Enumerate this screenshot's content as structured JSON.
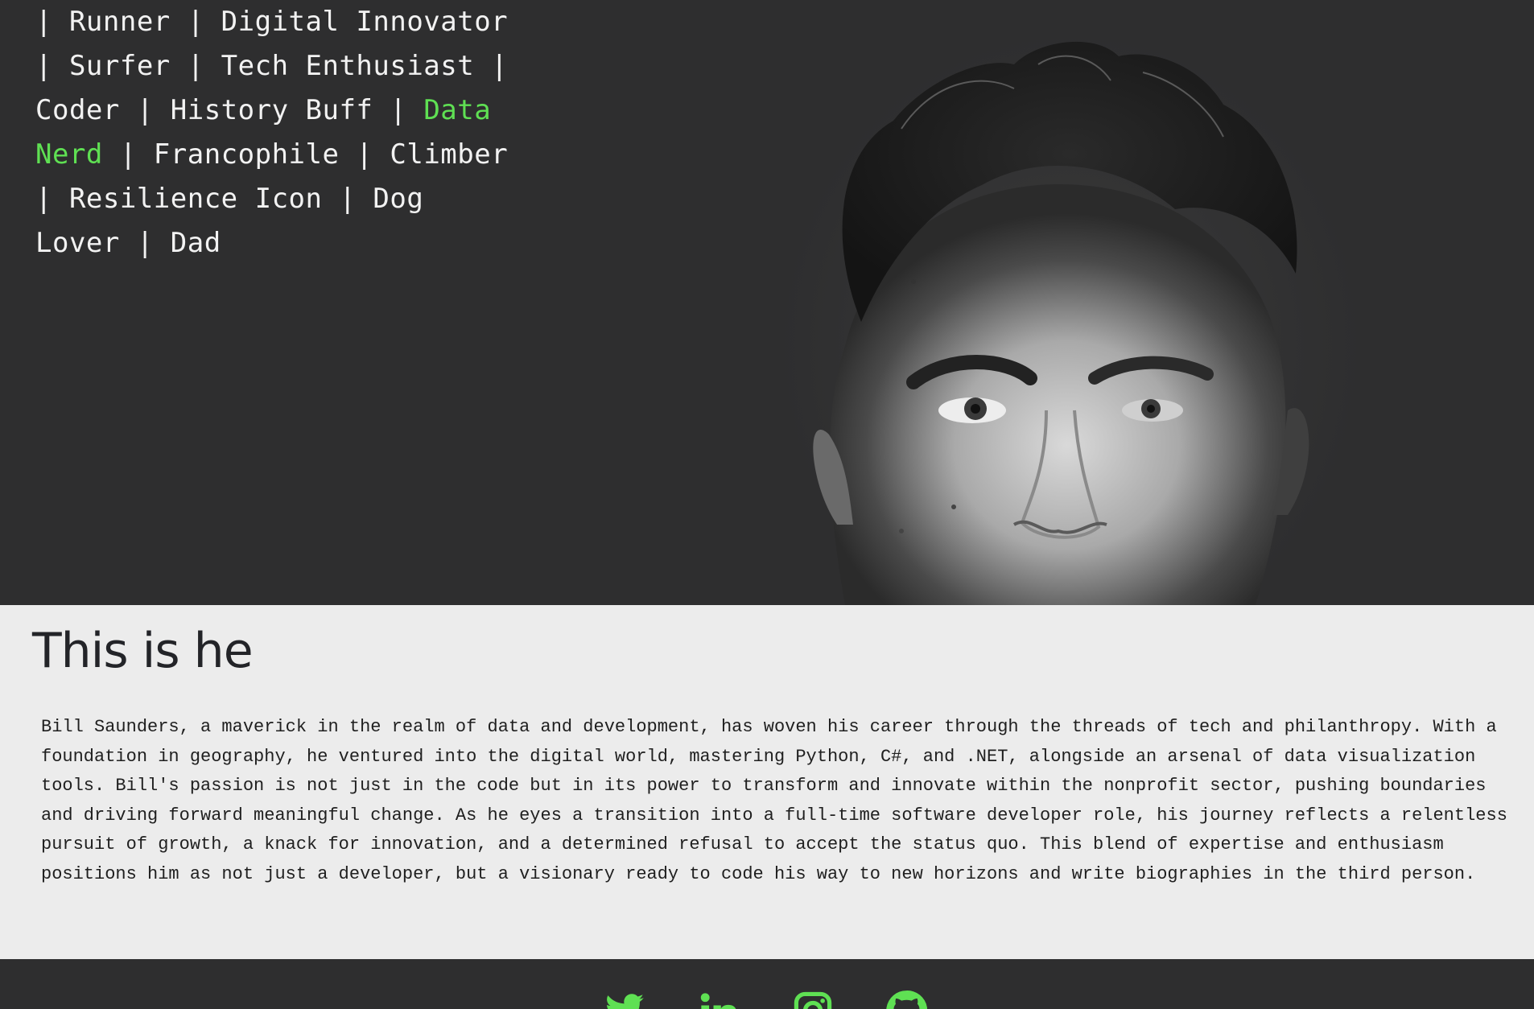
{
  "hero": {
    "tagline": [
      {
        "text": "| Runner | Digital Innovator",
        "highlight": false
      },
      {
        "text": "| Surfer | Tech Enthusiast |",
        "highlight": false
      },
      {
        "text": "Coder | History Buff | ",
        "highlight": false
      },
      {
        "text": "Data",
        "highlight": true
      },
      {
        "text": "Nerd",
        "highlight": true
      },
      {
        "text": " | Francophile | Climber",
        "highlight": false
      },
      {
        "text": "| Resilience Icon | Dog",
        "highlight": false
      },
      {
        "text": "Lover | Dad",
        "highlight": false
      }
    ],
    "accent_color": "#5fe053"
  },
  "about": {
    "title": "This is he",
    "body": "Bill Saunders, a maverick in the realm of data and development, has woven his career through the threads of tech and philanthropy. With a foundation in geography, he ventured into the digital world, mastering Python, C#, and .NET, alongside an arsenal of data visualization tools. Bill's passion is not just in the code but in its power to transform and innovate within the nonprofit sector, pushing boundaries and driving forward meaningful change. As he eyes a transition into a full-time software developer role, his journey reflects a relentless pursuit of growth, a knack for innovation, and a determined refusal to accept the status quo. This blend of expertise and enthusiasm positions him as not just a developer, but a visionary ready to code his way to new horizons and write biographies in the third person."
  },
  "footer": {
    "social": [
      {
        "icon": "twitter-icon"
      },
      {
        "icon": "linkedin-icon"
      },
      {
        "icon": "instagram-icon"
      },
      {
        "icon": "github-icon"
      }
    ],
    "icon_color": "#5fe053"
  },
  "colors": {
    "dark_bg": "#2e2e2f",
    "light_bg": "#ececec",
    "accent": "#5fe053"
  }
}
